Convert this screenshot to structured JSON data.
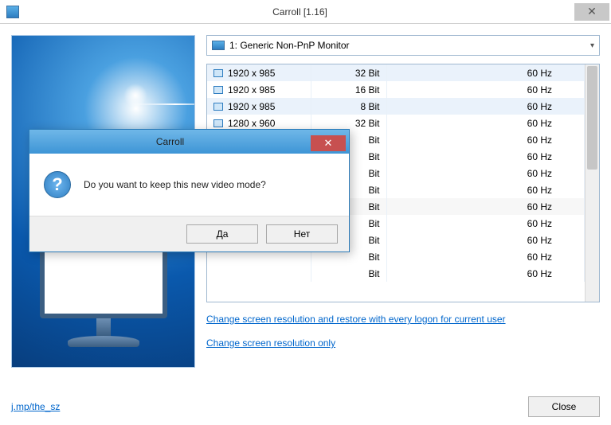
{
  "window": {
    "title": "Carroll [1.16]"
  },
  "monitor_select": {
    "label": "1: Generic Non-PnP Monitor"
  },
  "rows": [
    {
      "res": "1920 x 985",
      "bit": "32 Bit",
      "hz": "60 Hz"
    },
    {
      "res": "1920 x 985",
      "bit": "16 Bit",
      "hz": "60 Hz"
    },
    {
      "res": "1920 x 985",
      "bit": "8 Bit",
      "hz": "60 Hz"
    },
    {
      "res": "1280 x 960",
      "bit": "32 Bit",
      "hz": "60 Hz"
    },
    {
      "res": "",
      "bit": "Bit",
      "hz": "60 Hz"
    },
    {
      "res": "",
      "bit": "Bit",
      "hz": "60 Hz"
    },
    {
      "res": "",
      "bit": "Bit",
      "hz": "60 Hz"
    },
    {
      "res": "",
      "bit": "Bit",
      "hz": "60 Hz"
    },
    {
      "res": "",
      "bit": "Bit",
      "hz": "60 Hz"
    },
    {
      "res": "",
      "bit": "Bit",
      "hz": "60 Hz"
    },
    {
      "res": "",
      "bit": "Bit",
      "hz": "60 Hz"
    },
    {
      "res": "",
      "bit": "Bit",
      "hz": "60 Hz"
    },
    {
      "res": "",
      "bit": "Bit",
      "hz": "60 Hz"
    }
  ],
  "links": {
    "persist": "Change screen resolution and restore with every logon for current user",
    "once": "Change screen resolution only"
  },
  "footer": {
    "url": "j.mp/the_sz",
    "close": "Close"
  },
  "dialog": {
    "title": "Carroll",
    "message": "Do you want to keep this new video mode?",
    "yes": "Да",
    "no": "Нет"
  }
}
